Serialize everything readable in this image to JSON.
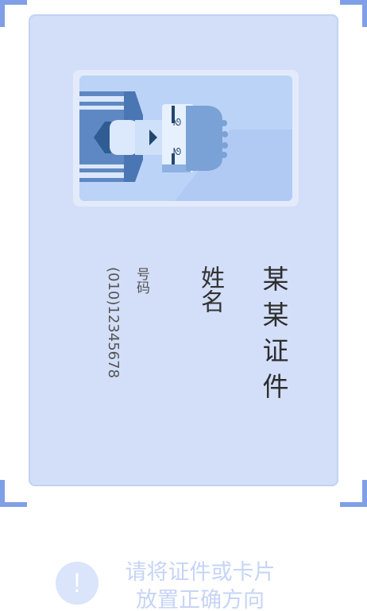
{
  "card": {
    "title": "某某证件",
    "name_label": "姓名",
    "number_label": "号码",
    "number_value": "(010)12345678",
    "photo": "avatar-illustration"
  },
  "hint": {
    "icon": "exclamation-icon",
    "icon_glyph": "!",
    "line1": "请将证件或卡片",
    "line2": "放置正确方向"
  },
  "colors": {
    "accent": "#7f9fe6",
    "card_bg": "#d3dff9",
    "hint_text": "#c6d4f6"
  }
}
